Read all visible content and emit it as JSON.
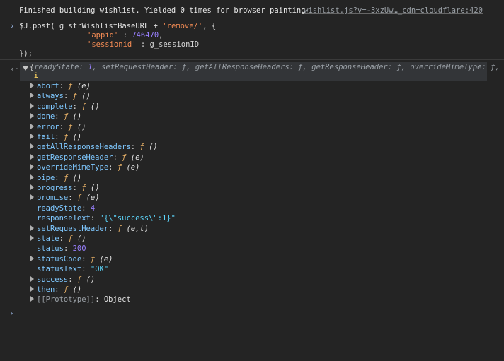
{
  "log": {
    "message": "Finished building wishlist. Yielded 0 times for browser painting",
    "source": "wishlist.js?v=-3xzUw…_cdn=cloudflare:420"
  },
  "input": {
    "prompt_symbol": "›",
    "line1_pre": "$J.post( g_strWishlistBaseURL + ",
    "line1_str": "'remove/'",
    "line1_post": ", {",
    "line2_key": "'appid'",
    "line2_mid": " : ",
    "line2_val": "746470",
    "line2_end": ",",
    "line3_key": "'sessionid'",
    "line3_post": " : g_sessionID",
    "line4": "});"
  },
  "result": {
    "arrow_symbol": "‹·",
    "summary": {
      "open": "{",
      "k1": "readyState: ",
      "v1": "1",
      "rest": ", setRequestHeader: ƒ, getAllResponseHeaders: ƒ, getResponseHeader: ƒ, overrideMimeType: ƒ, …}"
    },
    "info_badge": "i",
    "properties": [
      {
        "key": "abort",
        "kind": "fn",
        "params": "(e)",
        "expandable": true
      },
      {
        "key": "always",
        "kind": "fn",
        "params": "()",
        "expandable": true
      },
      {
        "key": "complete",
        "kind": "fn",
        "params": "()",
        "expandable": true
      },
      {
        "key": "done",
        "kind": "fn",
        "params": "()",
        "expandable": true
      },
      {
        "key": "error",
        "kind": "fn",
        "params": "()",
        "expandable": true
      },
      {
        "key": "fail",
        "kind": "fn",
        "params": "()",
        "expandable": true
      },
      {
        "key": "getAllResponseHeaders",
        "kind": "fn",
        "params": "()",
        "expandable": true
      },
      {
        "key": "getResponseHeader",
        "kind": "fn",
        "params": "(e)",
        "expandable": true
      },
      {
        "key": "overrideMimeType",
        "kind": "fn",
        "params": "(e)",
        "expandable": true
      },
      {
        "key": "pipe",
        "kind": "fn",
        "params": "()",
        "expandable": true
      },
      {
        "key": "progress",
        "kind": "fn",
        "params": "()",
        "expandable": true
      },
      {
        "key": "promise",
        "kind": "fn",
        "params": "(e)",
        "expandable": true
      },
      {
        "key": "readyState",
        "kind": "num",
        "value": "4",
        "expandable": false
      },
      {
        "key": "responseText",
        "kind": "str",
        "value": "\"{\\\"success\\\":1}\"",
        "expandable": false
      },
      {
        "key": "setRequestHeader",
        "kind": "fn",
        "params": "(e,t)",
        "expandable": true
      },
      {
        "key": "state",
        "kind": "fn",
        "params": "()",
        "expandable": true
      },
      {
        "key": "status",
        "kind": "num",
        "value": "200",
        "expandable": false
      },
      {
        "key": "statusCode",
        "kind": "fn",
        "params": "(e)",
        "expandable": true
      },
      {
        "key": "statusText",
        "kind": "str",
        "value": "\"OK\"",
        "expandable": false
      },
      {
        "key": "success",
        "kind": "fn",
        "params": "()",
        "expandable": true
      },
      {
        "key": "then",
        "kind": "fn",
        "params": "()",
        "expandable": true
      },
      {
        "key": "[[Prototype]]",
        "kind": "obj",
        "value": "Object",
        "expandable": true
      }
    ],
    "fn_glyph": "ƒ"
  },
  "bottom_prompt": "›",
  "colors": {
    "background": "#242424",
    "string": "#f28b54",
    "number": "#9980ff",
    "property_key": "#7fc8ff",
    "function_glyph": "#e6b067"
  }
}
